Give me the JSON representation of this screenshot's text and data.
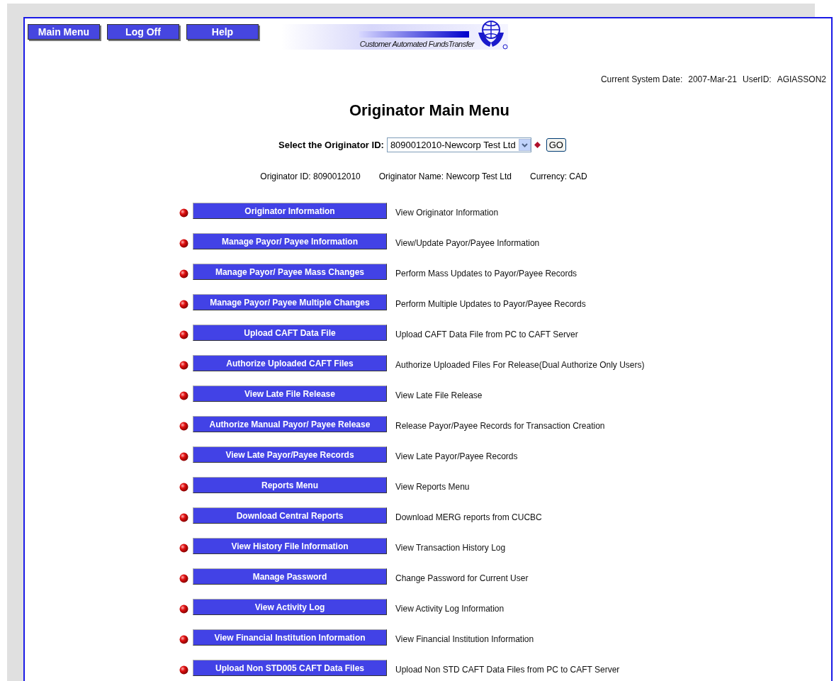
{
  "nav_buttons": [
    "Main Menu",
    "Log Off",
    "Help"
  ],
  "logo": {
    "tagline": "Customer Automated FundsTransfer"
  },
  "system_info": {
    "date_label": "Current System Date:",
    "date": "2007-Mar-21",
    "user_label": "UserID:",
    "user": "AGIASSON2"
  },
  "title": "Originator Main Menu",
  "selector": {
    "label": "Select the Originator ID:",
    "value": "8090012010-Newcorp Test Ltd",
    "button": "GO"
  },
  "details": [
    "Originator ID: 8090012010",
    "Originator Name: Newcorp Test Ltd",
    "Currency: CAD"
  ],
  "menu": [
    {
      "button": "Originator Information",
      "description": "View Originator Information"
    },
    {
      "button": "Manage Payor/ Payee Information",
      "description": "View/Update Payor/Payee Information"
    },
    {
      "button": "Manage Payor/ Payee Mass Changes",
      "description": "Perform Mass Updates to Payor/Payee Records"
    },
    {
      "button": "Manage Payor/ Payee Multiple Changes",
      "description": "Perform Multiple Updates to Payor/Payee Records"
    },
    {
      "button": "Upload CAFT Data File",
      "description": "Upload CAFT Data File from PC to CAFT Server"
    },
    {
      "button": "Authorize Uploaded CAFT Files",
      "description": "Authorize Uploaded Files For Release(Dual Authorize Only Users)"
    },
    {
      "button": "View Late File Release",
      "description": "View Late File Release"
    },
    {
      "button": "Authorize Manual Payor/ Payee Release",
      "description": "Release Payor/Payee Records for Transaction Creation"
    },
    {
      "button": "View Late Payor/Payee Records",
      "description": "View Late Payor/Payee Records"
    },
    {
      "button": "Reports Menu",
      "description": "View Reports Menu"
    },
    {
      "button": "Download Central Reports",
      "description": "Download MERG reports from CUCBC"
    },
    {
      "button": "View History File Information",
      "description": "View Transaction History Log"
    },
    {
      "button": "Manage Password",
      "description": "Change Password for Current User"
    },
    {
      "button": "View Activity Log",
      "description": "View Activity Log Information"
    },
    {
      "button": "View Financial Institution Information",
      "description": "View Financial Institution Information"
    },
    {
      "button": "Upload Non STD005 CAFT Data Files",
      "description": "Upload Non STD CAFT Data Files from PC to CAFT Server"
    }
  ]
}
